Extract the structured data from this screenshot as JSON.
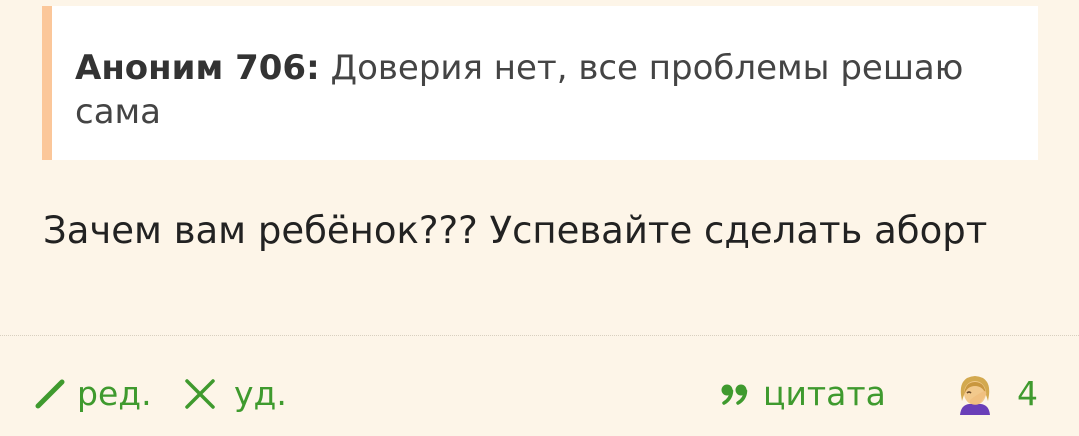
{
  "quote": {
    "author": "Аноним 706:",
    "text": "Доверия нет, все проблемы решаю сама"
  },
  "message": {
    "text": "Зачем вам ребёнок??? Успевайте сделать аборт"
  },
  "actions": {
    "edit_label": "ред.",
    "delete_label": "уд.",
    "quote_label": "цитата",
    "likes_count": "4",
    "likes_icon": "facepalm-emoji-icon"
  },
  "colors": {
    "background": "#fdf5e8",
    "quote_border": "#fbc79a",
    "action_green": "#3f9a2e"
  }
}
